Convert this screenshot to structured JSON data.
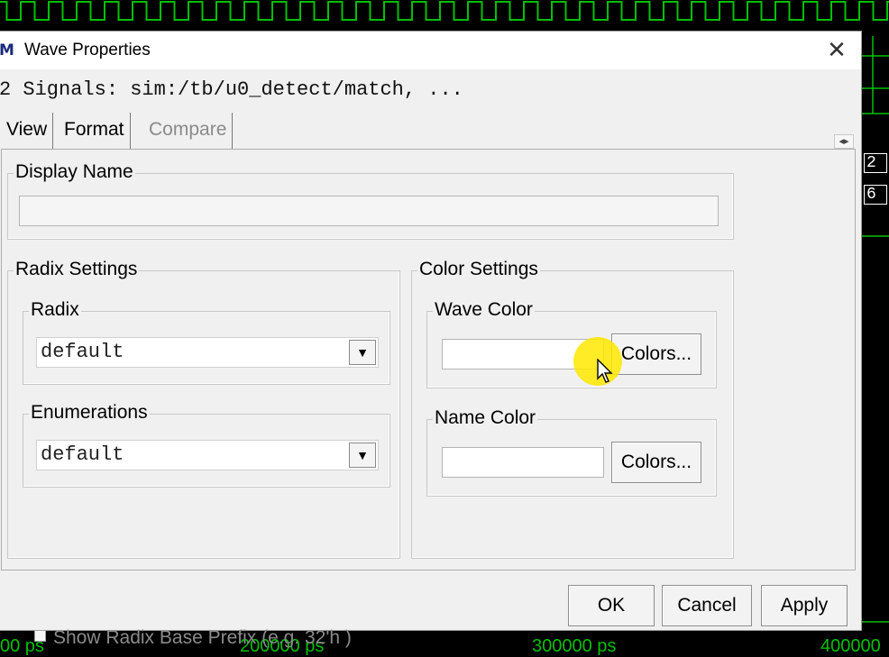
{
  "window": {
    "title": "Wave Properties",
    "app_icon": "modelsim-icon",
    "close_symbol": "✕"
  },
  "signals_line": "2 Signals: sim:/tb/u0_detect/match, ...",
  "tabs": [
    {
      "label": "View",
      "state": "selected"
    },
    {
      "label": "Format",
      "state": "enabled"
    },
    {
      "label": "Compare",
      "state": "disabled"
    }
  ],
  "tab_scroll_arrows": "◂▸",
  "display_name": {
    "legend": "Display Name",
    "value": ""
  },
  "radix_settings": {
    "legend": "Radix Settings",
    "radix": {
      "legend": "Radix",
      "value": "default"
    },
    "enumerations": {
      "legend": "Enumerations",
      "value": "default"
    },
    "show_prefix": {
      "label": "Show Radix Base Prefix (e.g. 32'h )",
      "checked": false,
      "enabled": false
    }
  },
  "color_settings": {
    "legend": "Color Settings",
    "wave_color": {
      "legend": "Wave Color",
      "value": "",
      "button": "Colors..."
    },
    "name_color": {
      "legend": "Name Color",
      "value": "",
      "button": "Colors..."
    }
  },
  "buttons": {
    "ok": "OK",
    "cancel": "Cancel",
    "apply": "Apply"
  },
  "background": {
    "time_labels": [
      "00 ps",
      "200000 ps",
      "300000 ps",
      "400000"
    ],
    "bus_values": [
      "2",
      "6"
    ],
    "wave_color": "#00c000"
  }
}
